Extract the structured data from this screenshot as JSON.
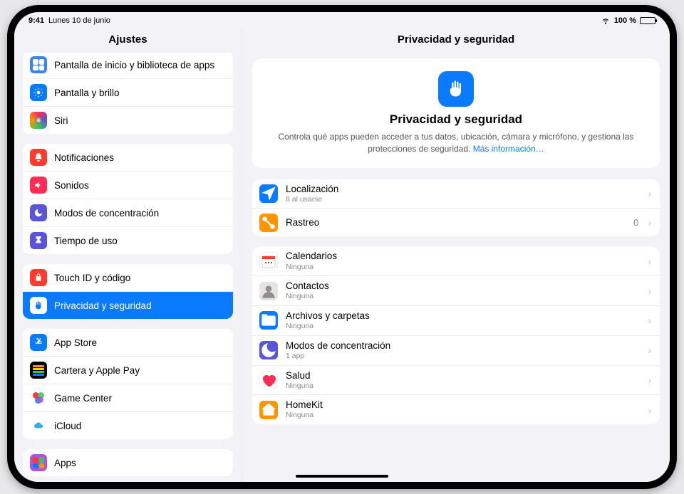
{
  "statusbar": {
    "time": "9:41",
    "date": "Lunes 10 de junio",
    "battery_text": "100 %"
  },
  "sidebar": {
    "title": "Ajustes",
    "groups": [
      {
        "items": [
          {
            "label": "Pantalla de inicio y biblioteca de apps"
          },
          {
            "label": "Pantalla y brillo"
          },
          {
            "label": "Siri"
          }
        ]
      },
      {
        "items": [
          {
            "label": "Notificaciones"
          },
          {
            "label": "Sonidos"
          },
          {
            "label": "Modos de concentración"
          },
          {
            "label": "Tiempo de uso"
          }
        ]
      },
      {
        "items": [
          {
            "label": "Touch ID y código"
          },
          {
            "label": "Privacidad y seguridad"
          }
        ]
      },
      {
        "items": [
          {
            "label": "App Store"
          },
          {
            "label": "Cartera y Apple Pay"
          },
          {
            "label": "Game Center"
          },
          {
            "label": "iCloud"
          }
        ]
      },
      {
        "items": [
          {
            "label": "Apps"
          }
        ]
      }
    ]
  },
  "main": {
    "title": "Privacidad y seguridad",
    "hero": {
      "heading": "Privacidad y seguridad",
      "body": "Controla qué apps pueden acceder a tus datos, ubicación, cámara y micrófono, y gestiona las protecciones de seguridad.",
      "link": "Más información…"
    },
    "sections": [
      {
        "rows": [
          {
            "title": "Localización",
            "sub": "8 al usarse",
            "trail": ""
          },
          {
            "title": "Rastreo",
            "sub": "",
            "trail": "0"
          }
        ]
      },
      {
        "rows": [
          {
            "title": "Calendarios",
            "sub": "Ninguna",
            "trail": ""
          },
          {
            "title": "Contactos",
            "sub": "Ninguna",
            "trail": ""
          },
          {
            "title": "Archivos y carpetas",
            "sub": "Ninguna",
            "trail": ""
          },
          {
            "title": "Modos de concentración",
            "sub": "1 app",
            "trail": ""
          },
          {
            "title": "Salud",
            "sub": "Ninguna",
            "trail": ""
          },
          {
            "title": "HomeKit",
            "sub": "Ninguna",
            "trail": ""
          }
        ]
      }
    ]
  },
  "colors": {
    "blue": "#0a7aff",
    "red": "#ff3b30",
    "orange": "#ff9500",
    "purple": "#5856d6",
    "green": "#34c759",
    "gray": "#8e8e93",
    "pink": "#ff2d55",
    "teal": "#32ade6"
  }
}
